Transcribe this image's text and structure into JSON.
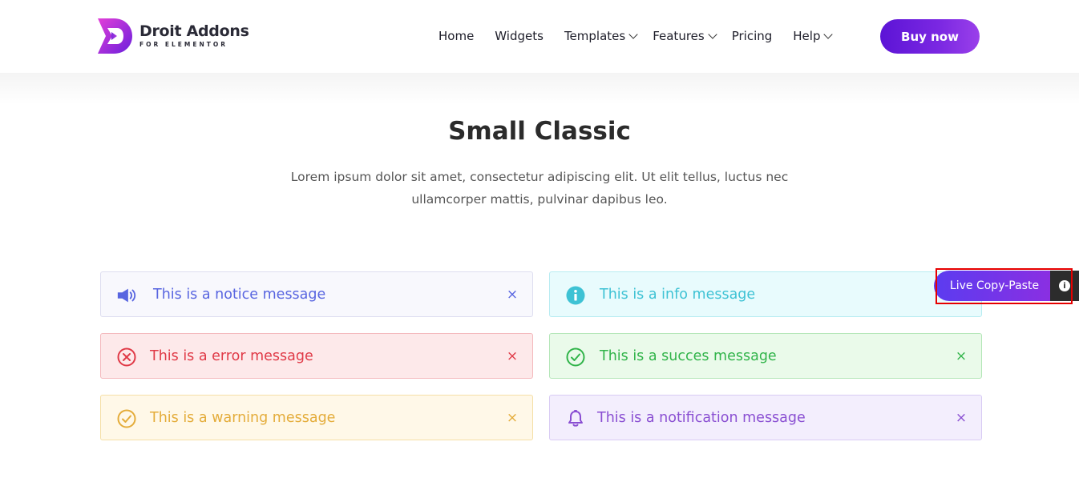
{
  "header": {
    "logo": {
      "name": "Droit Addons",
      "sub": "FOR ELEMENTOR"
    },
    "nav": [
      {
        "label": "Home",
        "has_dropdown": false
      },
      {
        "label": "Widgets",
        "has_dropdown": false
      },
      {
        "label": "Templates",
        "has_dropdown": true
      },
      {
        "label": "Features",
        "has_dropdown": true
      },
      {
        "label": "Pricing",
        "has_dropdown": false
      },
      {
        "label": "Help",
        "has_dropdown": true
      }
    ],
    "buy_label": "Buy now"
  },
  "section": {
    "title": "Small Classic",
    "description": "Lorem ipsum dolor sit amet, consectetur adipiscing elit. Ut elit tellus, luctus nec ullamcorper mattis, pulvinar dapibus leo."
  },
  "alerts": [
    {
      "type": "notice",
      "icon": "megaphone-icon",
      "text": "This is a notice message",
      "close": "×",
      "color": "#5865e0"
    },
    {
      "type": "info",
      "icon": "info-circle-icon",
      "text": "This is a info message",
      "close": "×",
      "color": "#3ec2d4"
    },
    {
      "type": "error",
      "icon": "x-circle-icon",
      "text": "This is a error message",
      "close": "×",
      "color": "#e03a47"
    },
    {
      "type": "success",
      "icon": "check-circle-icon",
      "text": "This is a succes message",
      "close": "×",
      "color": "#31b44a"
    },
    {
      "type": "warning",
      "icon": "check-circle-icon",
      "text": "This is a warning message",
      "close": "×",
      "color": "#e4ac3a"
    },
    {
      "type": "notification",
      "icon": "bell-icon",
      "text": "This is a notification message",
      "close": "×",
      "color": "#8a4fd2"
    }
  ],
  "live_copy": {
    "label": "Live Copy-Paste",
    "info_glyph": "i"
  },
  "colors": {
    "brand_purple": "#6a1fdc",
    "highlight_red": "#e60000"
  }
}
